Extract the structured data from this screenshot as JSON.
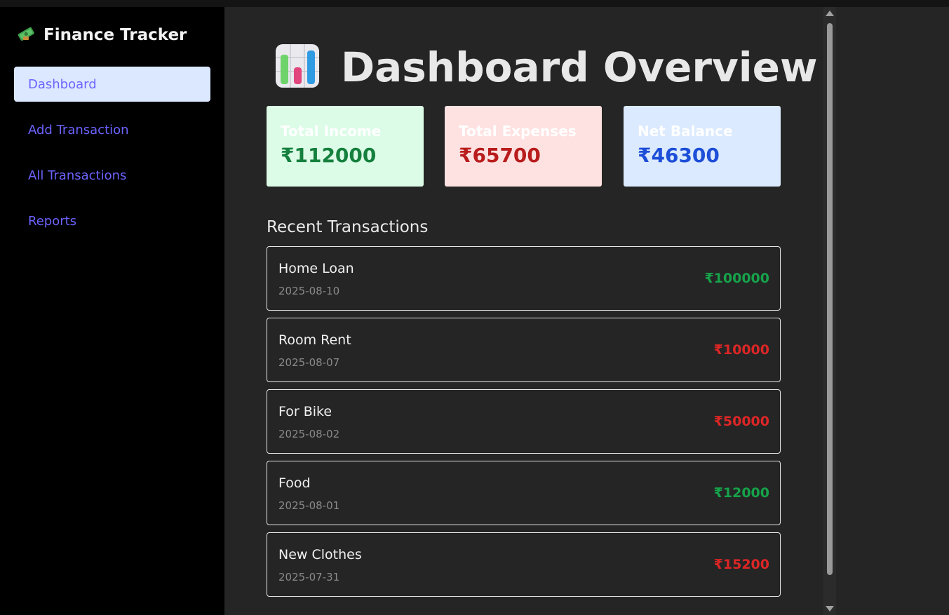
{
  "app": {
    "title": "Finance Tracker",
    "brand_icon": "money-icon"
  },
  "sidebar": {
    "items": [
      {
        "label": "Dashboard",
        "active": true
      },
      {
        "label": "Add Transaction",
        "active": false
      },
      {
        "label": "All Transactions",
        "active": false
      },
      {
        "label": "Reports",
        "active": false
      }
    ]
  },
  "main": {
    "title": "Dashboard Overview",
    "title_icon": "bar-chart-icon",
    "cards": [
      {
        "label": "Total Income",
        "value": "₹112000",
        "bg": "#dcfce7",
        "color": "#15803d"
      },
      {
        "label": "Total Expenses",
        "value": "₹65700",
        "bg": "#fee2e2",
        "color": "#b91c1c"
      },
      {
        "label": "Net Balance",
        "value": "₹46300",
        "bg": "#dbeafe",
        "color": "#1d4ed8"
      }
    ],
    "recent_title": "Recent Transactions",
    "transactions": [
      {
        "name": "Home Loan",
        "date": "2025-08-10",
        "amount": "₹100000",
        "type": "income"
      },
      {
        "name": "Room Rent",
        "date": "2025-08-07",
        "amount": "₹10000",
        "type": "expense"
      },
      {
        "name": "For Bike",
        "date": "2025-08-02",
        "amount": "₹50000",
        "type": "expense"
      },
      {
        "name": "Food",
        "date": "2025-08-01",
        "amount": "₹12000",
        "type": "income"
      },
      {
        "name": "New Clothes",
        "date": "2025-07-31",
        "amount": "₹15200",
        "type": "expense"
      }
    ]
  },
  "colors": {
    "income": "#16a34a",
    "expense": "#dc2626",
    "nav_link": "#6c63ff",
    "nav_active_bg": "#dbe8ff"
  }
}
